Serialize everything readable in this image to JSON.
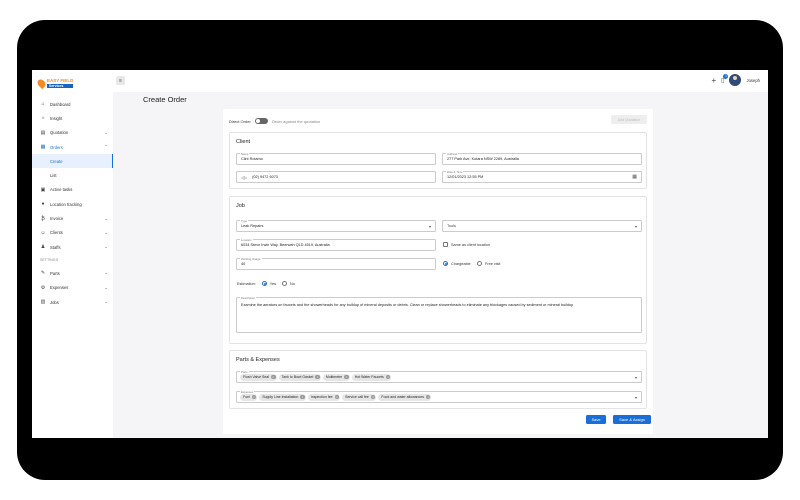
{
  "logo": {
    "line1": "EASY FIELD",
    "line2": "Services"
  },
  "sidebar": {
    "items": [
      {
        "label": "Dashboard",
        "icon": "home-icon"
      },
      {
        "label": "Insight",
        "icon": "lightbulb-icon"
      },
      {
        "label": "Quotation",
        "icon": "document-icon"
      },
      {
        "label": "Orders",
        "icon": "calendar-icon"
      },
      {
        "label": "Create"
      },
      {
        "label": "List"
      },
      {
        "label": "Active tasks",
        "icon": "tasks-icon"
      },
      {
        "label": "Location tracking",
        "icon": "location-pin-icon"
      },
      {
        "label": "Invoice",
        "icon": "invoice-icon"
      },
      {
        "label": "Clients",
        "icon": "clients-icon"
      },
      {
        "label": "Staffs",
        "icon": "staff-icon"
      },
      {
        "label": "SETTINGS"
      },
      {
        "label": "Parts",
        "icon": "wrench-icon"
      },
      {
        "label": "Expenses",
        "icon": "expenses-icon"
      },
      {
        "label": "Jobs",
        "icon": "jobs-icon"
      }
    ]
  },
  "topbar": {
    "user_name": "Joseph",
    "notification_count": "1"
  },
  "page": {
    "title": "Create Order"
  },
  "order": {
    "direct_order_label": "Direct Order",
    "toggle_label": "Order against the quotation",
    "disabled_button": "Add Quotation"
  },
  "client": {
    "title": "Client",
    "name_label": "Name",
    "name": "Clint Rolamo",
    "address_label": "Address",
    "address": "277 Park Ave, Kotara NSW 2289, Australia",
    "phone": "(02) 9472 6073",
    "datetime_label": "Date & Time",
    "datetime": "12/01/2023 12:55 PM"
  },
  "job": {
    "title": "Job",
    "type_label": "Type",
    "type": "Leak Repairs",
    "tools": "Tools",
    "location_label": "Location",
    "location": "6034 Steve Irwin Way, Beerwah QLD 4519, Australia",
    "same_as_client": "Same as client location",
    "working_charge_label": "Working charge",
    "working_charge": "40",
    "chargeable": "Chargeable",
    "free_visit": "Free visit",
    "estimation_label": "Estimation:",
    "yes": "Yes",
    "no": "No",
    "description_label": "Description",
    "description": "Examine the aerators on faucets and the showerheads for any buildup of mineral deposits or debris. Clean or replace showerheads to eliminate any blockages caused by sediment or mineral buildup"
  },
  "parts_expenses": {
    "title": "Parts & Expenses",
    "parts_label": "Parts",
    "parts": [
      "Flush Valve Seal",
      "Tank to Bowl Gasket",
      "Multimeter",
      "Hot Water Faucets"
    ],
    "expenses_label": "Expenses",
    "expenses": [
      "Fuel",
      "Supply Line Installation",
      "Inspection fee",
      "Service call fee",
      "Food and water allowances"
    ]
  },
  "actions": {
    "save": "Save",
    "save_assign": "Save & Assign"
  },
  "colors": {
    "accent": "#1a6ed8",
    "logo_orange": "#f28c28"
  }
}
